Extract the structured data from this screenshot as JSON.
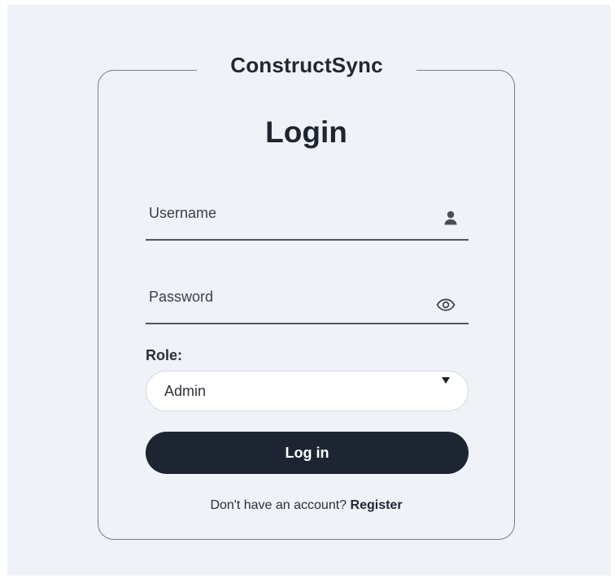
{
  "app": {
    "brand": "ConstructSync"
  },
  "login": {
    "heading": "Login",
    "username": {
      "placeholder": "Username",
      "value": "",
      "icon": "user-icon"
    },
    "password": {
      "placeholder": "Password",
      "value": "",
      "icon": "eye-icon"
    },
    "role": {
      "label": "Role:",
      "selected": "Admin"
    },
    "submit_label": "Log in",
    "footer": {
      "prompt": "Don't have an account?",
      "link": "Register"
    }
  },
  "colors": {
    "background": "#eff2f7",
    "card_border": "#7a7f86",
    "button": "#1d2533",
    "button_text": "#ffffff"
  }
}
